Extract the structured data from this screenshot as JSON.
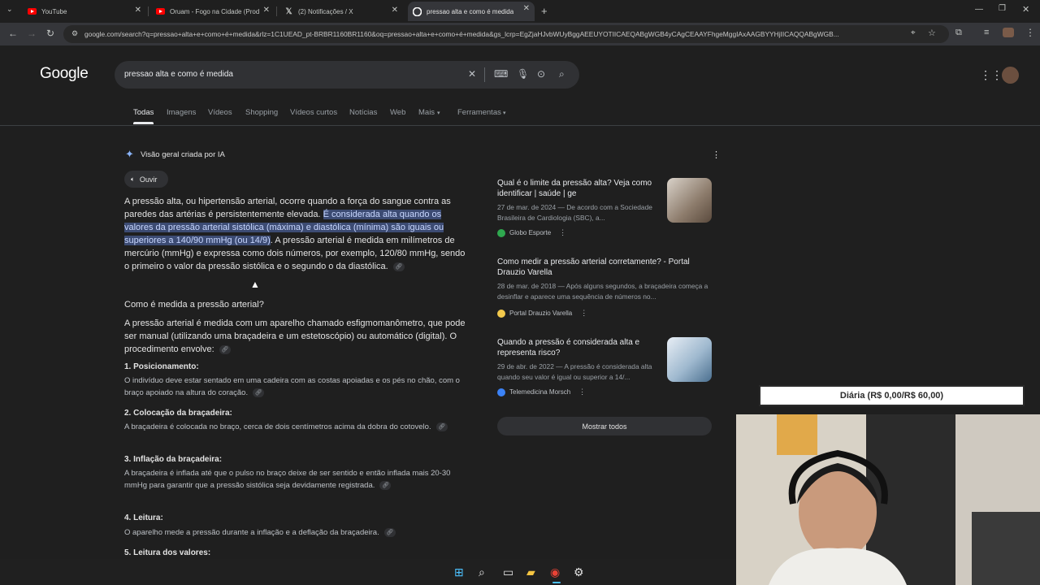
{
  "tabs": [
    {
      "title": "YouTube",
      "icon": "youtube-icon"
    },
    {
      "title": "Oruam - Fogo na Cidade (Prod",
      "icon": "youtube-icon"
    },
    {
      "title": "(2) Notificações / X",
      "icon": "x-icon"
    },
    {
      "title": "pressao alta e como é medida",
      "icon": "google-icon"
    }
  ],
  "new_tab_label": "+",
  "address_url": "google.com/search?q=pressao+alta+e+como+é+medida&rlz=1C1UEAD_pt-BRBR1160BR1160&oq=pressao+alta+e+como+é+medida&gs_lcrp=EgZjaHJvbWUyBggAEEUYOTIICAEQABgWGB4yCAgCEAAYFhgeMggIAxAAGBYYHjIICAQQABgWGB...",
  "google": {
    "logo": "Google",
    "query": "pressao alta e como é medida",
    "nav_tabs": [
      "Todas",
      "Imagens",
      "Vídeos",
      "Shopping",
      "Vídeos curtos",
      "Notícias",
      "Web",
      "Mais",
      "Ferramentas"
    ]
  },
  "ai_overview": {
    "label": "Visão geral criada por IA",
    "listen": "Ouvir",
    "para1_a": "A pressão alta, ou hipertensão arterial, ocorre quando a força do sangue contra as paredes das artérias é persistentemente elevada. ",
    "para1_hl": "É considerada alta quando os valores da pressão arterial sistólica (máxima) e diastólica (mínima) são iguais ou superiores a 140/90 mmHg (ou 14/9)",
    "para1_b": ". A pressão arterial é medida em milímetros de mercúrio (mmHg) e expressa como dois números, por exemplo, 120/80 mmHg, sendo o primeiro o valor da pressão sistólica e o segundo o da diastólica.",
    "q_heading": "Como é medida a pressão arterial?",
    "para2": "A pressão arterial é medida com um aparelho chamado esfigmomanômetro, que pode ser manual (utilizando uma braçadeira e um estetoscópio) ou automático (digital). O procedimento envolve:",
    "steps": [
      {
        "title": "1. Posicionamento:",
        "text": "O indivíduo deve estar sentado em uma cadeira com as costas apoiadas e os pés no chão, com o braço apoiado na altura do coração."
      },
      {
        "title": "2. Colocação da braçadeira:",
        "text": "A braçadeira é colocada no braço, cerca de dois centímetros acima da dobra do cotovelo."
      },
      {
        "title": "3. Inflação da braçadeira:",
        "text": "A braçadeira é inflada até que o pulso no braço deixe de ser sentido e então inflada mais 20-30 mmHg para garantir que a pressão sistólica seja devidamente registrada."
      },
      {
        "title": "4. Leitura:",
        "text": "O aparelho mede a pressão durante a inflação e a deflação da braçadeira."
      },
      {
        "title": "5. Leitura dos valores:",
        "text": ""
      }
    ]
  },
  "sources": [
    {
      "title": "Qual é o limite da pressão alta? Veja como identificar | saúde | ge",
      "snippet": "27 de mar. de 2024 — De acordo com a Sociedade Brasileira de Cardiologia (SBC), a...",
      "site": "Globo Esporte",
      "site_color": "#2fa84f"
    },
    {
      "title": "Como medir a pressão arterial corretamente? - Portal Drauzio Varella",
      "snippet": "28 de mar. de 2018 — Após alguns segundos, a braçadeira começa a desinflar e aparece uma sequência de números no...",
      "site": "Portal Drauzio Varella",
      "site_color": "#f2c94c"
    },
    {
      "title": "Quando a pressão é considerada alta e representa risco?",
      "snippet": "29 de abr. de 2022 — A pressão é considerada alta quando seu valor é igual ou superior a 14/...",
      "site": "Telemedicina Morsch",
      "site_color": "#3b82f6"
    }
  ],
  "show_all": "Mostrar todos",
  "overlay": {
    "daily": "Diária (R$ 0,00/R$ 60,00)"
  }
}
